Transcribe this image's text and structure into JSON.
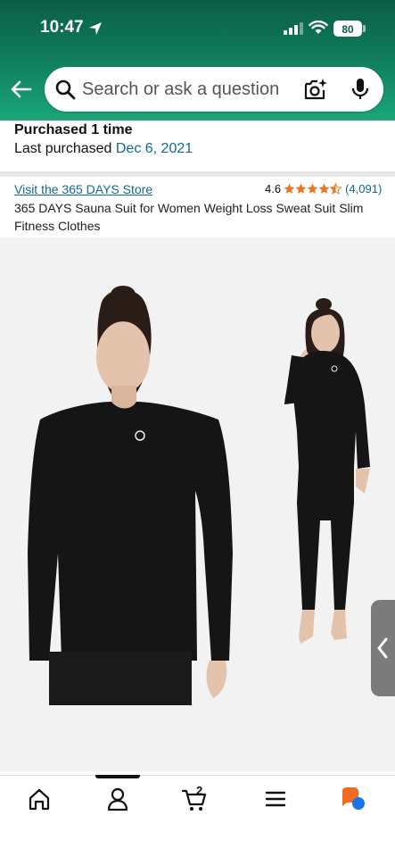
{
  "status_bar": {
    "time": "10:47",
    "battery": "80"
  },
  "search": {
    "placeholder": "Search or ask a question"
  },
  "purchase_info": {
    "purchased_label": "Purchased 1 time",
    "last_purchased_label": "Last purchased ",
    "last_purchased_date": "Dec 6, 2021"
  },
  "product": {
    "store_link": "Visit the 365 DAYS Store",
    "rating": "4.6",
    "rating_stars": 4.6,
    "rating_count": "(4,091)",
    "title": "365 DAYS Sauna Suit for Women Weight Loss Sweat Suit Slim Fitness Clothes"
  },
  "tab_bar": {
    "active_tab": "account",
    "cart_count": "2"
  },
  "colors": {
    "header_green": "#0f7a59",
    "link_blue": "#0f6a8b",
    "star_orange": "#e87722"
  }
}
